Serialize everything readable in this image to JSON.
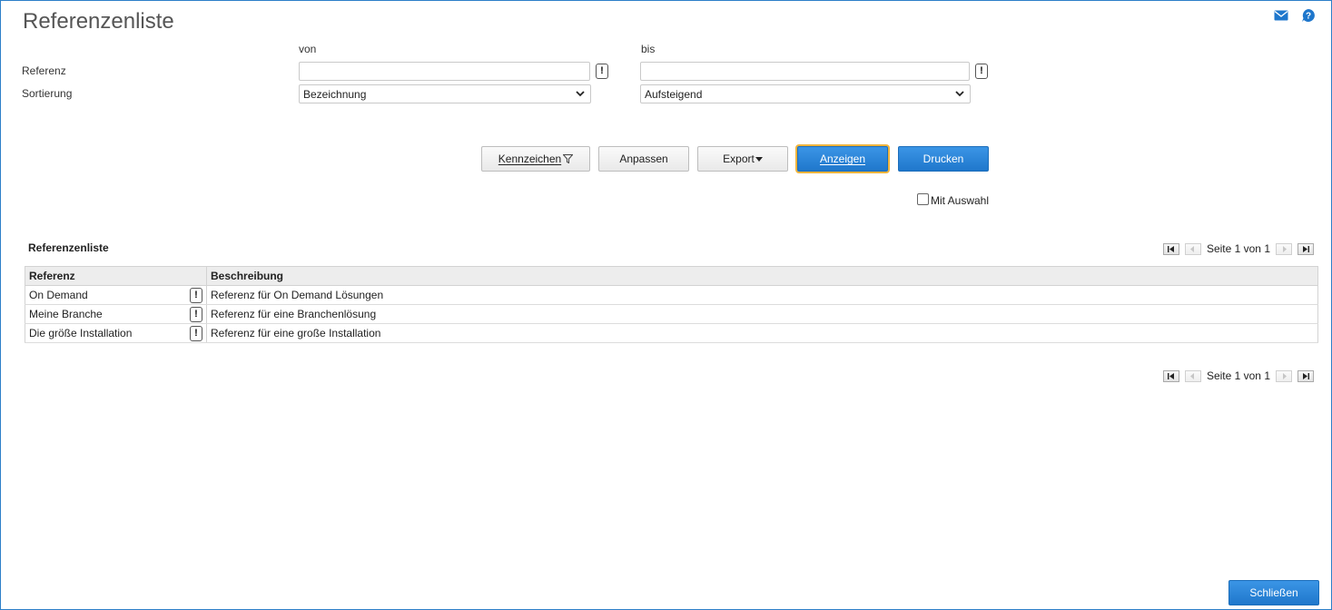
{
  "page": {
    "title": "Referenzenliste"
  },
  "filter": {
    "col_from": "von",
    "col_to": "bis",
    "referenz_label": "Referenz",
    "referenz_from_value": "",
    "referenz_to_value": "",
    "sort_label": "Sortierung",
    "sort_field_selected": "Bezeichnung",
    "sort_order_selected": "Aufsteigend"
  },
  "toolbar": {
    "kennzeichen_label": "Kennzeichen",
    "anpassen_label": "Anpassen",
    "export_label": "Export",
    "anzeigen_label": "Anzeigen",
    "drucken_label": "Drucken",
    "mit_auswahl_label": "Mit Auswahl"
  },
  "list": {
    "title": "Referenzenliste",
    "pager_text": "Seite 1 von 1",
    "columns": [
      "Referenz",
      "Beschreibung"
    ],
    "rows": [
      {
        "referenz": "On Demand",
        "beschreibung": "Referenz für On Demand Lösungen"
      },
      {
        "referenz": "Meine Branche",
        "beschreibung": "Referenz für eine Branchenlösung"
      },
      {
        "referenz": "Die größe Installation",
        "beschreibung": "Referenz für eine große Installation"
      }
    ]
  },
  "footer": {
    "close_label": "Schließen"
  },
  "icons": {
    "mail": "mail-icon",
    "help": "help-icon",
    "filter": "filter-icon",
    "caret": "caret-down-icon",
    "excl": "exclamation-icon"
  },
  "colors": {
    "accent": "#1f77cc",
    "focus": "#f0b43c",
    "frame": "#2c7fc9",
    "title": "#555555"
  }
}
